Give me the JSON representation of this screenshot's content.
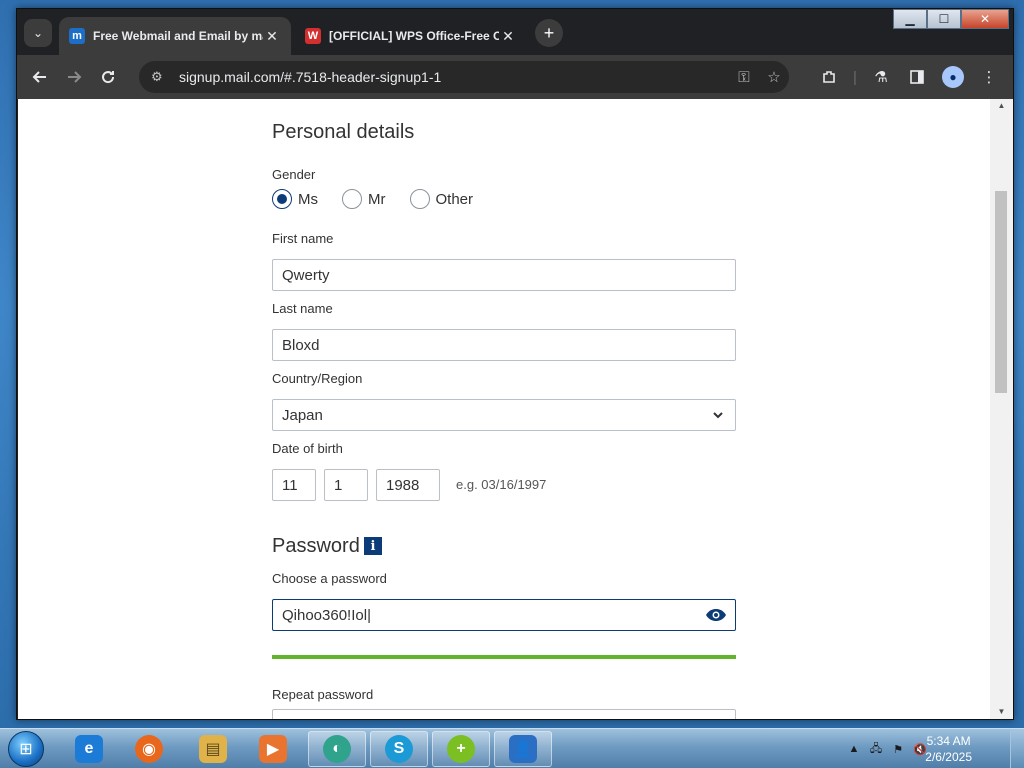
{
  "browser": {
    "tabs": [
      {
        "title": "Free Webmail and Email by mail.com",
        "favicon": "m",
        "active": true
      },
      {
        "title": "[OFFICIAL] WPS Office-Free Office",
        "favicon": "W",
        "active": false
      }
    ],
    "new_tab_glyph": "+",
    "tab_menu_glyph": "⌄",
    "close_glyph": "✕",
    "address": "signup.mail.com/#.7518-header-signup1-1",
    "window_controls": {
      "minimize": "▁",
      "maximize": "☐",
      "close": "✕"
    }
  },
  "form": {
    "personal_title": "Personal details",
    "gender_label": "Gender",
    "gender_options": [
      {
        "label": "Ms",
        "checked": true
      },
      {
        "label": "Mr",
        "checked": false
      },
      {
        "label": "Other",
        "checked": false
      }
    ],
    "first_name_label": "First name",
    "first_name_value": "Qwerty",
    "last_name_label": "Last name",
    "last_name_value": "Bloxd",
    "country_label": "Country/Region",
    "country_value": "Japan",
    "dob_label": "Date of birth",
    "dob_month": "11",
    "dob_day": "1",
    "dob_year": "1988",
    "dob_hint": "e.g. 03/16/1997",
    "password_title": "Password",
    "info_glyph": "i",
    "choose_password_label": "Choose a password",
    "password_value": "Qihoo360!Iol|",
    "password_strength": 1.0,
    "repeat_password_label": "Repeat password"
  },
  "taskbar": {
    "apps": [
      {
        "name": "Internet Explorer",
        "glyph": "e",
        "color": "#1b7bd6"
      },
      {
        "name": "Firefox",
        "glyph": "◉",
        "color": "#e8671c"
      },
      {
        "name": "File Explorer",
        "glyph": "▤",
        "color": "#e0b24a"
      },
      {
        "name": "Media Player",
        "glyph": "▶",
        "color": "#e8742f"
      },
      {
        "name": "Chrome-like app",
        "glyph": "◐",
        "color": "#2fa38c"
      },
      {
        "name": "Skype",
        "glyph": "S",
        "color": "#1c9ad6"
      },
      {
        "name": "Green Plus",
        "glyph": "+",
        "color": "#7bbf22"
      },
      {
        "name": "User Accounts",
        "glyph": "👤",
        "color": "#2b6fc4"
      }
    ],
    "time": "5:34 AM",
    "date": "2/6/2025"
  },
  "colors": {
    "accent": "#0c3c78",
    "strength_bar": "#64b32c",
    "browser_dark": "#202124"
  }
}
